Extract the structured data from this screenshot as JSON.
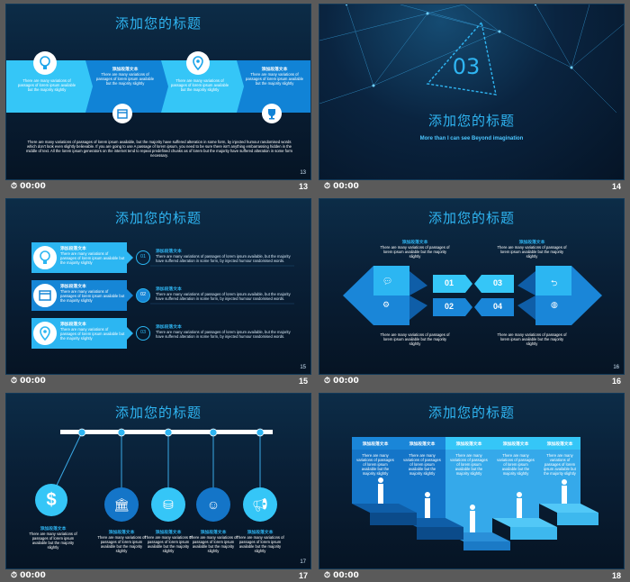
{
  "footer_time": "00:00",
  "subheading": "添加段落文本",
  "text_short": "There are many variations of passages of lorem ipsum available, but the majority have suffered alteration in some form, by injected humour randomised words.",
  "text_box": "There are many variations of passages of lorem ipsum available but the majority slightly",
  "slides": [
    {
      "num": "13",
      "title": "添加您的标题",
      "bottom_text": "There are many variations of passages of lorem ipsum available, but the majority have suffered alteration in some form, by injected humour randomised words which don't look even slightly believable. If you are going to use A passage of lorem ipsum, you need to be sure there isn't anything embarrassing hidden in the middle of text. All the lorem ipsum generators on the internet tend to repeat predefined chunks as of lorem but the majority have suffered alteration in some form necessary."
    },
    {
      "num": "14",
      "title": "添加您的标题",
      "big_num": "03",
      "subtitle": "More than I can see Beyond imagination"
    },
    {
      "num": "15",
      "title": "添加您的标题",
      "badges": [
        "01",
        "02",
        "03"
      ]
    },
    {
      "num": "16",
      "title": "添加您的标题",
      "labels": [
        "01",
        "02",
        "03",
        "04"
      ]
    },
    {
      "num": "17",
      "title": "添加您的标题"
    },
    {
      "num": "18",
      "title": "添加您的标题"
    }
  ],
  "colors": {
    "accent": "#2fb5f2",
    "dark": "#0a2038",
    "light_blue": "#3ec0f5"
  }
}
